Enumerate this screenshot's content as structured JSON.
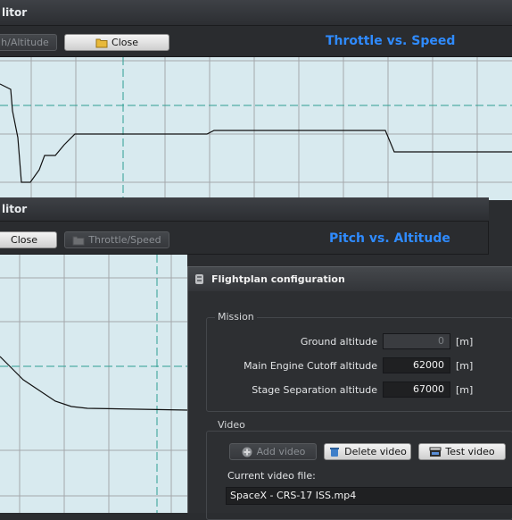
{
  "win1": {
    "title": "litor",
    "tab_left": "h/Altitude",
    "close": "Close",
    "chart_title": "Throttle vs. Speed"
  },
  "win2": {
    "title": "litor",
    "close": "Close",
    "tab_right": "Throttle/Speed",
    "chart_title": "Pitch vs. Altitude"
  },
  "dialog": {
    "title": "Flightplan configuration",
    "mission": {
      "label": "Mission",
      "fields": [
        {
          "label": "Ground altitude",
          "value": "0",
          "unit": "[m]"
        },
        {
          "label": "Main Engine Cutoff altitude",
          "value": "62000",
          "unit": "[m]"
        },
        {
          "label": "Stage Separation altitude",
          "value": "67000",
          "unit": "[m]"
        }
      ]
    },
    "video": {
      "label": "Video",
      "add": "Add video",
      "delete": "Delete video",
      "test": "Test video",
      "current_label": "Current video file:",
      "current_value": "SpaceX - CRS-17 ISS.mp4"
    }
  },
  "colors": {
    "accent": "#2f8bff",
    "plot_bg": "#d8eaef",
    "grid": "#a4a8ab",
    "guide": "#2e9e93"
  }
}
